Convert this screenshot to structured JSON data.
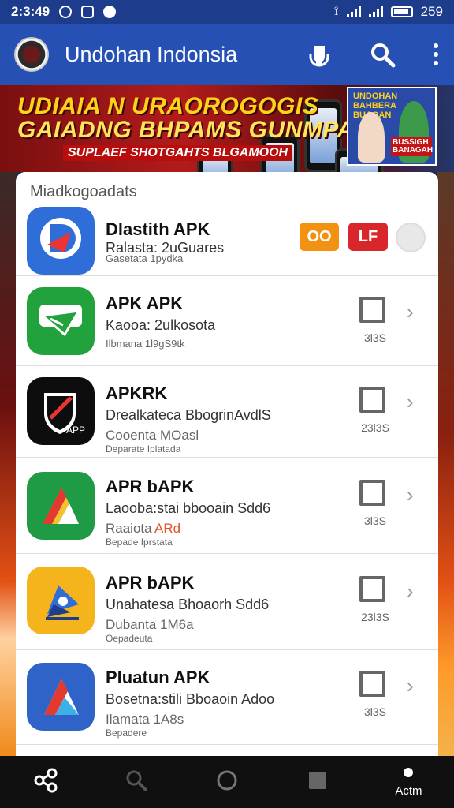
{
  "status_bar": {
    "time": "2:3:49",
    "battery_text": "259",
    "icons": [
      "settings-icon",
      "message-icon",
      "circle-icon",
      "vibrate-icon",
      "signal-icon",
      "signal-icon",
      "battery-icon"
    ]
  },
  "app_bar": {
    "title": "Undohan Indonsia",
    "actions": [
      "mic-icon",
      "search-icon",
      "more-vert-icon"
    ]
  },
  "banner": {
    "line1": "UDIAIA N URAOROGOGIS",
    "line2": "GAIADNG BHPAMS GUNMPAR",
    "line3": "SUPLAEF SHOTGAHTS BLGAMOOH",
    "poster_title": "UNDOHAN BAHBERA BUAOAN",
    "poster_sticker": "BUSSIGH BANAGAH"
  },
  "list": {
    "header": "Miadkogoadats",
    "items": [
      {
        "name": "Dlastith APK",
        "subtitle": "Ralasta: 2uGuares",
        "meta": "Gasetata  1pydka",
        "badge1": "OO",
        "badge2": "LF"
      },
      {
        "name": "APK APK",
        "subtitle": "Kaooa: 2ulkosota",
        "meta": "Ilbmana  1l9gS9tk",
        "size": "3l3S"
      },
      {
        "name": "APKRK",
        "subtitle": "Drealkateca  BbogrinAvdlS",
        "meta": "Cooenta  MOasl",
        "meta2": "Deparate  Iplatada",
        "size": "23l3S",
        "icon_text": "APP"
      },
      {
        "name": "APR bAPK",
        "subtitle": "Laooba:stai  bbooain Sdd6",
        "meta": "Raaiota",
        "meta_accent": "ARd",
        "meta2": "Bepade  Iprstata",
        "size": "3l3S"
      },
      {
        "name": "APR bAPK",
        "subtitle": "Unahatesa  Bhoaorh Sdd6",
        "meta": "Dubanta  1M6a",
        "meta2": "Oepadeuta",
        "size": "23l3S"
      },
      {
        "name": "Pluatun APK",
        "subtitle": "Bosetna:stili  Bboaoin Adoo",
        "meta": "Ilamata  1A8s",
        "meta2": "Bepadere",
        "size": "3l3S"
      }
    ]
  },
  "nav_bar": {
    "items": [
      "share-icon",
      "search-icon",
      "home-circle-icon",
      "recents-square-icon"
    ],
    "active_label": "Actm"
  },
  "colors": {
    "status_bar": "#1e3c8c",
    "app_bar": "#2650b3",
    "badge_orange": "#f39212",
    "badge_red": "#d9262a",
    "nav_bar": "#101010"
  }
}
